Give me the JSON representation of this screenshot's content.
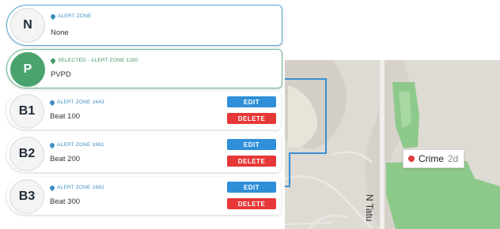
{
  "zones": [
    {
      "initial": "N",
      "tag": "ALERT ZONE",
      "name": "None"
    },
    {
      "initial": "P",
      "tag": "SELECTED - ALERT ZONE 1280",
      "name": "PVPD"
    },
    {
      "initial": "B1",
      "tag": "ALERT ZONE 1643",
      "name": "Beat 100"
    },
    {
      "initial": "B2",
      "tag": "ALERT ZONE 1661",
      "name": "Beat 200"
    },
    {
      "initial": "B3",
      "tag": "ALERT ZONE 1662",
      "name": "Beat 300"
    }
  ],
  "buttons": {
    "edit": "EDIT",
    "delete": "DELETE"
  },
  "map": {
    "crime_label": "Crime",
    "crime_age": "2d",
    "street": "N Tatu"
  },
  "colors": {
    "accent_blue": "#2f8fd8",
    "delete_red": "#e63838",
    "selected_green": "#4aa36e",
    "crime_dot": "#e33b3b",
    "park_green": "#8dc98a"
  }
}
